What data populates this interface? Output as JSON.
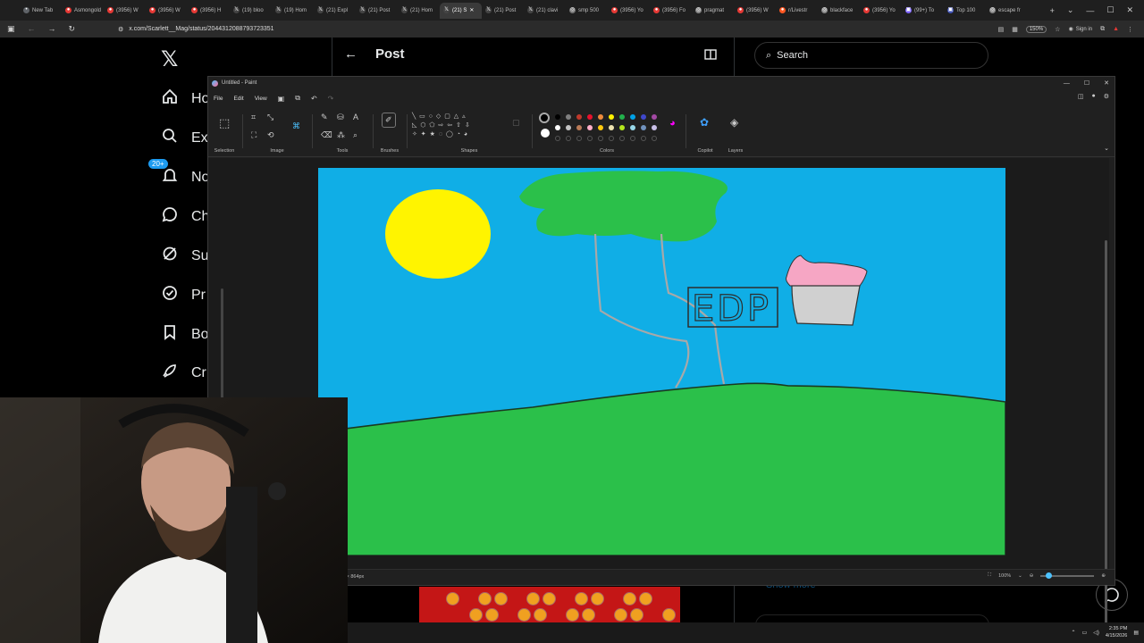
{
  "browser": {
    "tabs": [
      {
        "label": "New Tab",
        "color": "#5f6368",
        "glyph": "•",
        "active": false
      },
      {
        "label": "Asmongold",
        "color": "#e53935",
        "glyph": "●",
        "active": false
      },
      {
        "label": "(3956) W",
        "color": "#e53935",
        "glyph": "●",
        "active": false
      },
      {
        "label": "(3956) W",
        "color": "#e53935",
        "glyph": "●",
        "active": false
      },
      {
        "label": "(3956) H",
        "color": "#e53935",
        "glyph": "●",
        "active": false
      },
      {
        "label": "(19) bloo",
        "color": "#444",
        "glyph": "𝕏",
        "active": false
      },
      {
        "label": "(19) Hom",
        "color": "#444",
        "glyph": "𝕏",
        "active": false
      },
      {
        "label": "(21) Expl",
        "color": "#444",
        "glyph": "𝕏",
        "active": false
      },
      {
        "label": "(21) Post",
        "color": "#444",
        "glyph": "𝕏",
        "active": false
      },
      {
        "label": "(21) Hom",
        "color": "#444",
        "glyph": "𝕏",
        "active": false
      },
      {
        "label": "(21) S",
        "color": "#444",
        "glyph": "𝕏",
        "active": true
      },
      {
        "label": "(21) Post",
        "color": "#444",
        "glyph": "𝕏",
        "active": false
      },
      {
        "label": "(21) clavi",
        "color": "#444",
        "glyph": "𝕏",
        "active": false
      },
      {
        "label": "smp 500",
        "color": "#777",
        "glyph": "◎",
        "active": false
      },
      {
        "label": "(3956) Yo",
        "color": "#e53935",
        "glyph": "●",
        "active": false
      },
      {
        "label": "(3956) Fo",
        "color": "#e53935",
        "glyph": "●",
        "active": false
      },
      {
        "label": "pragmat",
        "color": "#888",
        "glyph": "◎",
        "active": false
      },
      {
        "label": "(3956) W",
        "color": "#e53935",
        "glyph": "●",
        "active": false
      },
      {
        "label": "r/Livestr",
        "color": "#ff5722",
        "glyph": "●",
        "active": false
      },
      {
        "label": "blackface",
        "color": "#888",
        "glyph": "◎",
        "active": false
      },
      {
        "label": "(3956) Yo",
        "color": "#e53935",
        "glyph": "●",
        "active": false
      },
      {
        "label": "(99+) To",
        "color": "#7b61ff",
        "glyph": "▣",
        "active": false
      },
      {
        "label": "Top 100",
        "color": "#3f51b5",
        "glyph": "▣",
        "active": false
      },
      {
        "label": "escape fr",
        "color": "#888",
        "glyph": "◎",
        "active": false
      }
    ],
    "url": "x.com/Scarlett__Mag/status/2044312088793723351",
    "zoom": "150%",
    "signin": "Sign in"
  },
  "xnav": {
    "items": [
      {
        "label": "Ho",
        "icon": "home-icon"
      },
      {
        "label": "Ex",
        "icon": "search-icon"
      },
      {
        "label": "No",
        "icon": "bell-icon",
        "badge": "20+"
      },
      {
        "label": "Ch",
        "icon": "chat-icon"
      },
      {
        "label": "Su",
        "icon": "slash-icon"
      },
      {
        "label": "Pr",
        "icon": "verified-icon"
      },
      {
        "label": "Bo",
        "icon": "bookmark-icon"
      },
      {
        "label": "Cr",
        "icon": "rocket-icon"
      }
    ]
  },
  "post": {
    "title": "Post",
    "search_placeholder": "Search",
    "show_more": "Show more"
  },
  "paint": {
    "title": "Untitled - Paint",
    "menu": [
      "File",
      "Edit",
      "View"
    ],
    "groups": {
      "selection": "Selection",
      "image": "Image",
      "tools": "Tools",
      "brushes": "Brushes",
      "shapes": "Shapes",
      "colors": "Colors",
      "copilot": "Copilot",
      "layers": "Layers"
    },
    "palette_row1": [
      "#000000",
      "#7f7f7f",
      "#c0392b",
      "#e8112d",
      "#ef8b3c",
      "#fff200",
      "#22b14c",
      "#00a2e8",
      "#3f48cc",
      "#a349a4"
    ],
    "palette_row2": [
      "#ffffff",
      "#c3c3c3",
      "#b97a57",
      "#ffaec9",
      "#ffc90e",
      "#efe4b0",
      "#b5e61d",
      "#99d9ea",
      "#7092be",
      "#c8bfe7"
    ],
    "canvas_text": "EDP",
    "canvas_size": "6 × 864px",
    "zoom_label": "100%"
  },
  "taskbar": {
    "time": "2:35 PM",
    "date": "4/15/2026"
  }
}
